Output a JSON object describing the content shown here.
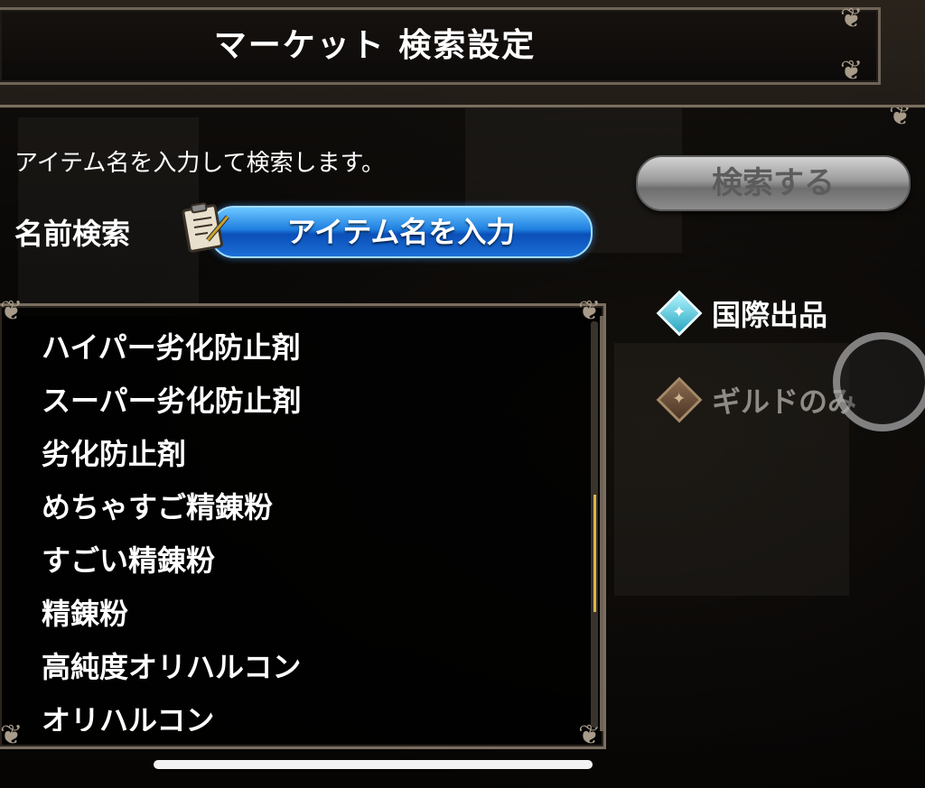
{
  "header": {
    "title": "マーケット 検索設定"
  },
  "search": {
    "instruction": "アイテム名を入力して検索します。",
    "name_label": "名前検索",
    "input_placeholder": "アイテム名を入力",
    "search_button": "検索する"
  },
  "items": [
    "ハイパー劣化防止剤",
    "スーパー劣化防止剤",
    "劣化防止剤",
    "めちゃすご精錬粉",
    "すごい精錬粉",
    "精錬粉",
    "高純度オリハルコン",
    "オリハルコン"
  ],
  "options": [
    {
      "label": "国際出品",
      "selected": true,
      "icon": "diamond-star-icon",
      "color": "#2aa6c0"
    },
    {
      "label": "ギルドのみ",
      "selected": false,
      "icon": "diamond-star-icon",
      "color": "#8a6a4e"
    }
  ],
  "scroll": {
    "position": 0.45
  }
}
